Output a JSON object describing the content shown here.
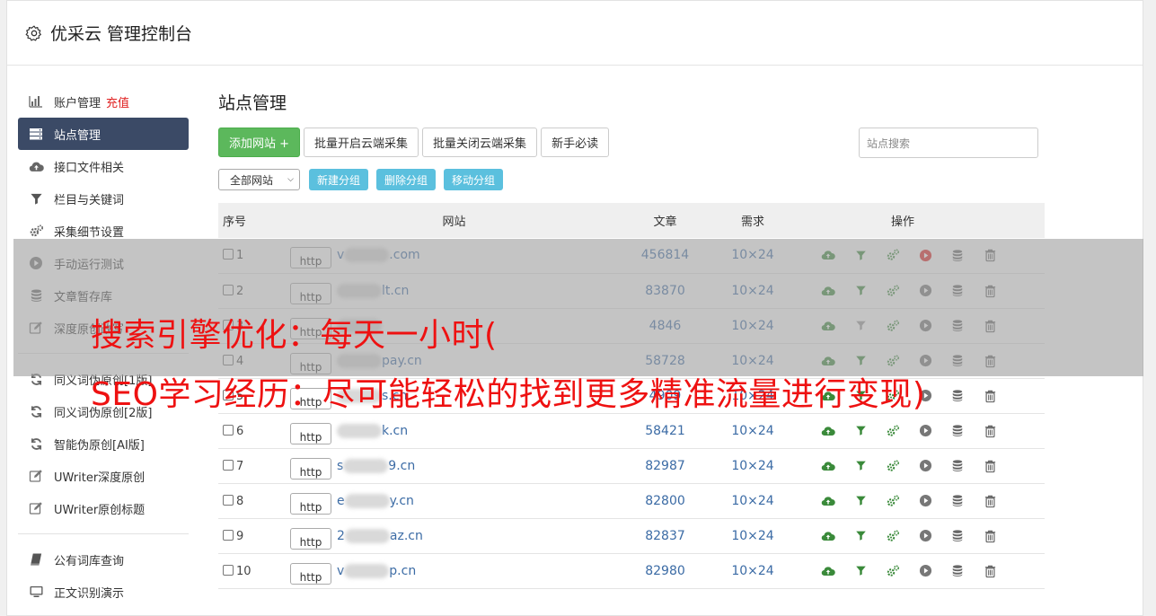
{
  "app": {
    "title": "优采云 管理控制台"
  },
  "sidebar": {
    "items": [
      {
        "label": "账户管理",
        "extra": "充值",
        "icon": "bar-chart-icon"
      },
      {
        "label": "站点管理",
        "icon": "server-icon",
        "active": true
      },
      {
        "label": "接口文件相关",
        "icon": "cloud-upload-icon"
      },
      {
        "label": "栏目与关键词",
        "icon": "filter-icon"
      },
      {
        "label": "采集细节设置",
        "icon": "gears-icon"
      },
      {
        "label": "手动运行测试",
        "icon": "play-circle-icon"
      },
      {
        "label": "文章暂存库",
        "icon": "database-icon"
      },
      {
        "label": "深度原创改写",
        "icon": "edit-icon"
      }
    ],
    "items2": [
      {
        "label": "同义词伪原创[1版]",
        "icon": "refresh-icon"
      },
      {
        "label": "同义词伪原创[2版]",
        "icon": "refresh-icon"
      },
      {
        "label": "智能伪原创[AI版]",
        "icon": "refresh-icon"
      },
      {
        "label": "UWriter深度原创",
        "icon": "edit-icon"
      },
      {
        "label": "UWriter原创标题",
        "icon": "edit-icon"
      }
    ],
    "items3": [
      {
        "label": "公有词库查询",
        "icon": "book-icon"
      },
      {
        "label": "正文识别演示",
        "icon": "monitor-icon"
      }
    ]
  },
  "main": {
    "title": "站点管理",
    "buttons": {
      "add": "添加网站 +",
      "batch_open": "批量开启云端采集",
      "batch_close": "批量关闭云端采集",
      "guide": "新手必读"
    },
    "search_placeholder": "站点搜索",
    "group_select": "全部网站",
    "group_buttons": {
      "new": "新建分组",
      "delete": "删除分组",
      "move": "移动分组"
    },
    "table": {
      "headers": {
        "id": "序号",
        "site": "网站",
        "articles": "文章",
        "need": "需求",
        "ops": "操作"
      },
      "rows": [
        {
          "id": "1",
          "proto": "http",
          "pre": "v",
          "post": ".com",
          "articles": "456814",
          "need": "10×24",
          "active": true
        },
        {
          "id": "2",
          "proto": "http",
          "pre": "",
          "post": "lt.cn",
          "articles": "83870",
          "need": "10×24"
        },
        {
          "id": "3",
          "proto": "http",
          "pre": "",
          "post": "",
          "articles": "4846",
          "need": "10×24",
          "filter_gray": true
        },
        {
          "id": "4",
          "proto": "http",
          "pre": "",
          "post": "pay.cn",
          "articles": "58728",
          "need": "10×24"
        },
        {
          "id": "5",
          "proto": "http",
          "pre": "",
          "post": "s.cn",
          "articles": "4909",
          "need": "10×24"
        },
        {
          "id": "6",
          "proto": "http",
          "pre": "",
          "post": "k.cn",
          "articles": "58421",
          "need": "10×24"
        },
        {
          "id": "7",
          "proto": "http",
          "pre": "s",
          "post": "9.cn",
          "articles": "82987",
          "need": "10×24"
        },
        {
          "id": "8",
          "proto": "http",
          "pre": "e",
          "post": "y.cn",
          "articles": "82800",
          "need": "10×24"
        },
        {
          "id": "9",
          "proto": "http",
          "pre": "2",
          "post": "az.cn",
          "articles": "82837",
          "need": "10×24"
        },
        {
          "id": "10",
          "proto": "http",
          "pre": "v",
          "post": "p.cn",
          "articles": "82980",
          "need": "10×24"
        }
      ]
    }
  },
  "watermark": {
    "line1": "搜索引擎优化：每天一小时(",
    "line2": "SEO学习经历：尽可能轻松的找到更多精准流量进行变现)"
  },
  "colors": {
    "accent": "#3b4a66",
    "green": "#5cb85c",
    "info": "#5bc0de",
    "link": "#3b6ba5",
    "watermark": "#ee1111"
  }
}
